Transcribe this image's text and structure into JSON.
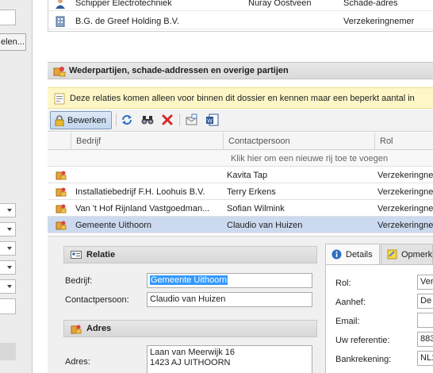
{
  "left_panel": {
    "button_label": "elen..."
  },
  "top_rows": [
    {
      "col1": "Schipper Electrotechniek",
      "col2": "Nuray Oostveen",
      "col3": "Schade-adres"
    },
    {
      "col1": "B.G. de Greef Holding B.V.",
      "col2": "",
      "col3": "Verzekeringnemer"
    }
  ],
  "section": {
    "title": "Wederpartijen, schade-addressen en overige partijen"
  },
  "info": {
    "text": "Deze relaties komen alleen voor binnen dit dossier en kennen maar een beperkt aantal in"
  },
  "toolbar": {
    "edit_label": "Bewerken"
  },
  "grid": {
    "columns": [
      "Bedrijf",
      "Contactpersoon",
      "Rol"
    ],
    "new_row_hint": "Klik hier om een nieuwe rij toe te voegen",
    "rows": [
      {
        "bedrijf": "",
        "contact": "Kavita Tap",
        "rol": "Verzekeringne"
      },
      {
        "bedrijf": "Installatiebedrijf F.H. Loohuis B.V.",
        "contact": "Terry Erkens",
        "rol": "Verzekeringne"
      },
      {
        "bedrijf": "Van 't Hof Rijnland Vastgoedman...",
        "contact": "Sofian Wilmink",
        "rol": "Verzekeringne"
      },
      {
        "bedrijf": "Gemeente Uithoorn",
        "contact": "Claudio van Huizen",
        "rol": "Verzekeringne"
      }
    ]
  },
  "relatie": {
    "title": "Relatie",
    "bedrijf_label": "Bedrijf:",
    "bedrijf_value": "Gemeente Uithoorn",
    "contact_label": "Contactpersoon:",
    "contact_value": "Claudio van Huizen"
  },
  "adres": {
    "title": "Adres",
    "label": "Adres:",
    "line1": "Laan van Meerwijk 16",
    "line2": "1423 AJ  UITHOORN"
  },
  "tabs": {
    "details": "Details",
    "opmerkingen": "Opmerki"
  },
  "details": {
    "rol_label": "Rol:",
    "rol_value": "Ver",
    "aanhef_label": "Aanhef:",
    "aanhef_value": "De",
    "email_label": "Email:",
    "email_value": "",
    "ref_label": "Uw referentie:",
    "ref_value": "883",
    "bank_label": "Bankrekening:",
    "bank_value": "NL1"
  }
}
